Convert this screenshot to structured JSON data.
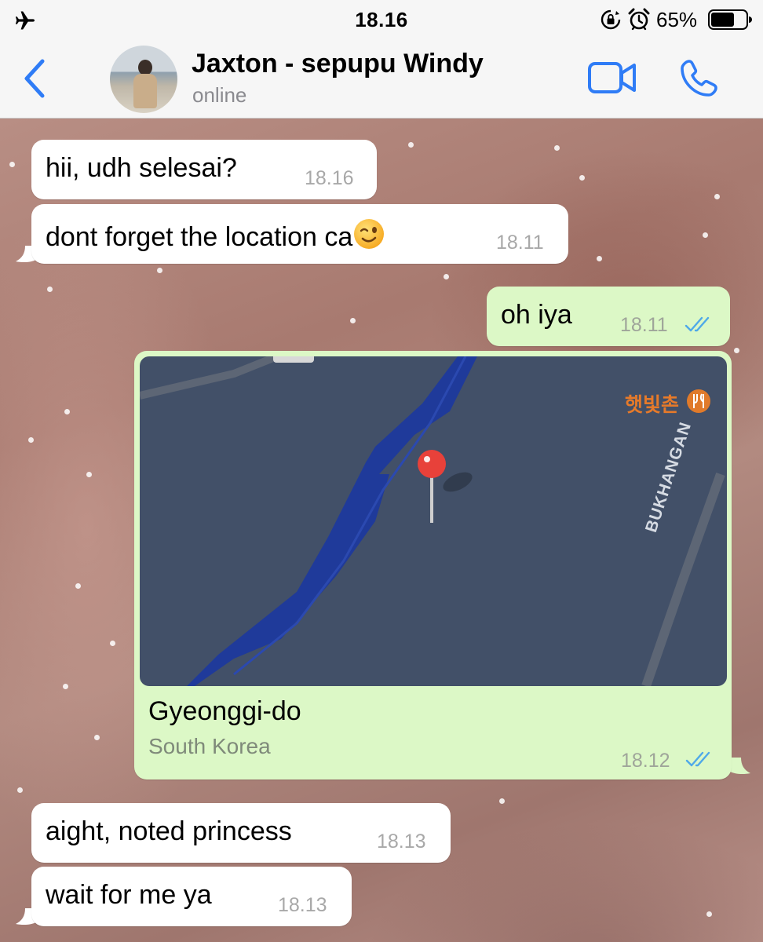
{
  "status_bar": {
    "time": "18.16",
    "battery": "65%",
    "icons": [
      "airplane-icon",
      "rotation-lock-icon",
      "alarm-icon",
      "battery-icon"
    ]
  },
  "header": {
    "contact_name": "Jaxton - sepupu Windy",
    "contact_status": "online",
    "icons": [
      "back-chevron-icon",
      "video-camera-icon",
      "phone-icon"
    ],
    "accent_color": "#2f7cf6"
  },
  "messages": [
    {
      "direction": "incoming",
      "text": "hii, udh selesai?",
      "time": "18.16"
    },
    {
      "direction": "incoming",
      "text": "dont forget the location ca",
      "emoji": "winking-face-emoji",
      "time": "18.11"
    },
    {
      "direction": "outgoing",
      "text": "oh iya",
      "time": "18.11",
      "status": "read"
    },
    {
      "direction": "outgoing",
      "type": "location",
      "title": "Gyeonggi-do",
      "subtitle": "South Korea",
      "map_poi_label": "햇빛촌",
      "map_road_label": "BUKHANGAN",
      "time": "18.12",
      "status": "read"
    },
    {
      "direction": "incoming",
      "text": "aight, noted princess",
      "time": "18.13"
    },
    {
      "direction": "incoming",
      "text": "wait for me ya",
      "time": "18.13"
    }
  ],
  "colors": {
    "incoming_bubble": "#ffffff",
    "outgoing_bubble": "#dcf8c6",
    "read_ticks": "#4fa9e8",
    "map_background": "#425068",
    "map_river": "#1f3a9a",
    "map_pin": "#e8413a"
  }
}
